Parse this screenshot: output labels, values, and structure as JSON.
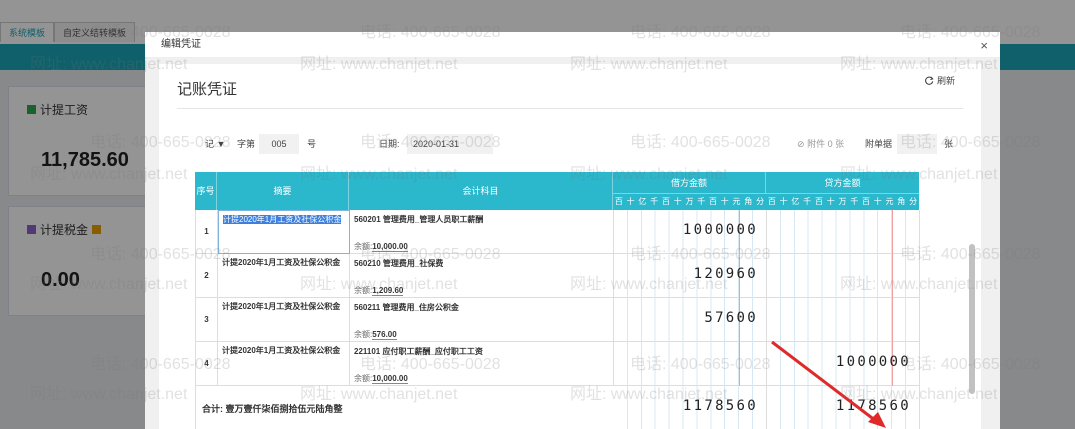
{
  "app": {
    "tabs": [
      {
        "label": "系统模板"
      },
      {
        "label": "自定义结转模板"
      }
    ],
    "cards": [
      {
        "title": "计提工资",
        "amount": "11,785.60"
      },
      {
        "title": "计提税金",
        "amount": "0.00"
      }
    ]
  },
  "dialog": {
    "header_title": "编辑凭证",
    "close_glyph": "×",
    "voucher_title": "记账凭证",
    "refresh_label": "刷新",
    "voucher_word": "记",
    "zi_label": "字第",
    "voucher_number": "005",
    "hao_label": "号",
    "date_label": "日期:",
    "date_value": "2020-01-31",
    "attachment_label": "附件 0 张",
    "attach_doc_label": "附单据",
    "zhang_label": "张"
  },
  "table": {
    "headers": {
      "seq": "序号",
      "summary": "摘要",
      "account": "会计科目",
      "debit": "借方金额",
      "credit": "贷方金额"
    },
    "digit_units": [
      "百",
      "十",
      "亿",
      "千",
      "百",
      "十",
      "万",
      "千",
      "百",
      "十",
      "元",
      "角",
      "分"
    ],
    "rows": [
      {
        "seq": "1",
        "summary": "计提2020年1月工资及社保公积金",
        "account": "560201 管理费用_管理人员职工薪酬",
        "balance_label": "余额:",
        "balance": "10,000.00",
        "debit": "1000000",
        "credit": ""
      },
      {
        "seq": "2",
        "summary": "计提2020年1月工资及社保公积金",
        "account": "560210 管理费用_社保费",
        "balance_label": "余额:",
        "balance": "1,209.60",
        "debit": "120960",
        "credit": ""
      },
      {
        "seq": "3",
        "summary": "计提2020年1月工资及社保公积金",
        "account": "560211 管理费用_住房公积金",
        "balance_label": "余额:",
        "balance": "576.00",
        "debit": "57600",
        "credit": ""
      },
      {
        "seq": "4",
        "summary": "计提2020年1月工资及社保公积金",
        "account": "221101 应付职工薪酬_应付职工工资",
        "balance_label": "余额:",
        "balance": "10,000.00",
        "debit": "",
        "credit": "1000000"
      }
    ],
    "total": {
      "label": "合计:  壹万壹仟柒佰捌拾伍元陆角整",
      "debit": "1178560",
      "credit": "1178560"
    }
  },
  "watermark": {
    "phone": "电话: 400-665-0028",
    "site": "网址: www.chanjet.net"
  },
  "colors": {
    "header_teal": "#2bb7cc",
    "app_teal": "#1aa6b7",
    "arrow_red": "#e02a2a"
  }
}
